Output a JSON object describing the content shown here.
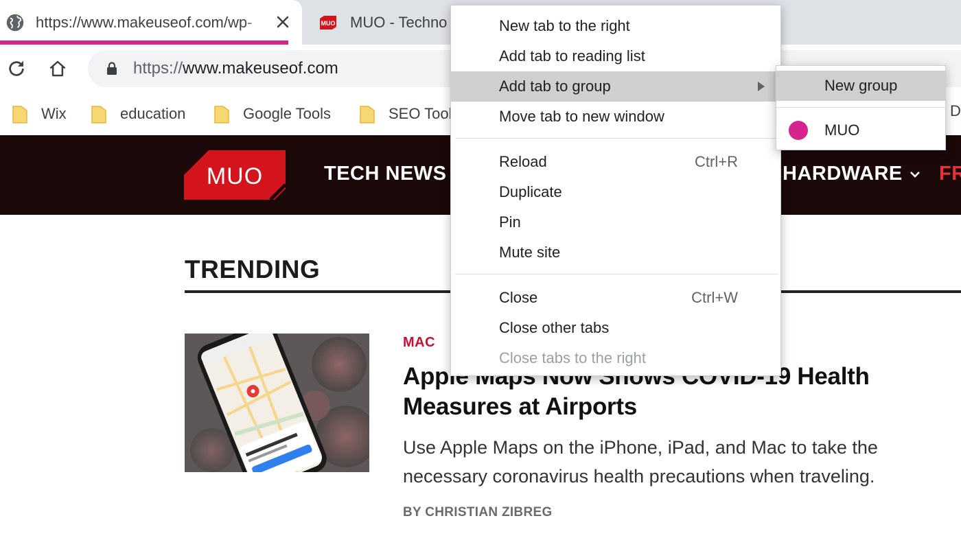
{
  "browser": {
    "tabs": [
      {
        "title": "https://www.makeuseof.com/wp-",
        "icon": "globe-icon",
        "active": true,
        "group_color": "#d6248f"
      },
      {
        "title": "MUO - Techno",
        "icon": "muo-favicon",
        "active": false
      }
    ],
    "url": {
      "scheme": "https://",
      "host": "www.makeuseof.com"
    },
    "bookmarks": [
      {
        "label": "Wix",
        "icon": "folder-icon"
      },
      {
        "label": "education",
        "icon": "folder-icon"
      },
      {
        "label": "Google Tools",
        "icon": "folder-icon"
      },
      {
        "label": "SEO Tool",
        "icon": "folder-icon"
      }
    ],
    "bookmark_trailing": "D"
  },
  "site": {
    "logo_text": "MUO",
    "nav": {
      "tech_news": "TECH NEWS",
      "hardware": "HARDWARE",
      "free": "FR"
    },
    "trending_heading": "TRENDING",
    "article": {
      "category": "MAC",
      "headline": "Apple Maps Now Shows COVID-19 Health Measures at Airports",
      "excerpt": "Use Apple Maps on the iPhone, iPad, and Mac to take the necessary coronavirus health precautions when traveling.",
      "byline": "BY CHRISTIAN ZIBREG"
    }
  },
  "context_menu": {
    "items": [
      {
        "label": "New tab to the right"
      },
      {
        "label": "Add tab to reading list"
      },
      {
        "label": "Add tab to group",
        "has_submenu": true,
        "highlighted": true
      },
      {
        "label": "Move tab to new window"
      },
      {
        "label": "Reload",
        "shortcut": "Ctrl+R"
      },
      {
        "label": "Duplicate"
      },
      {
        "label": "Pin"
      },
      {
        "label": "Mute site"
      },
      {
        "label": "Close",
        "shortcut": "Ctrl+W"
      },
      {
        "label": "Close other tabs"
      },
      {
        "label": "Close tabs to the right",
        "disabled": true
      }
    ]
  },
  "submenu": {
    "new_group": "New group",
    "groups": [
      {
        "label": "MUO",
        "color": "#d6248f"
      }
    ]
  },
  "colors": {
    "accent": "#d6248f",
    "muo_red": "#d3141d",
    "site_nav_bg": "#1b0808",
    "category_red": "#c8102e"
  }
}
